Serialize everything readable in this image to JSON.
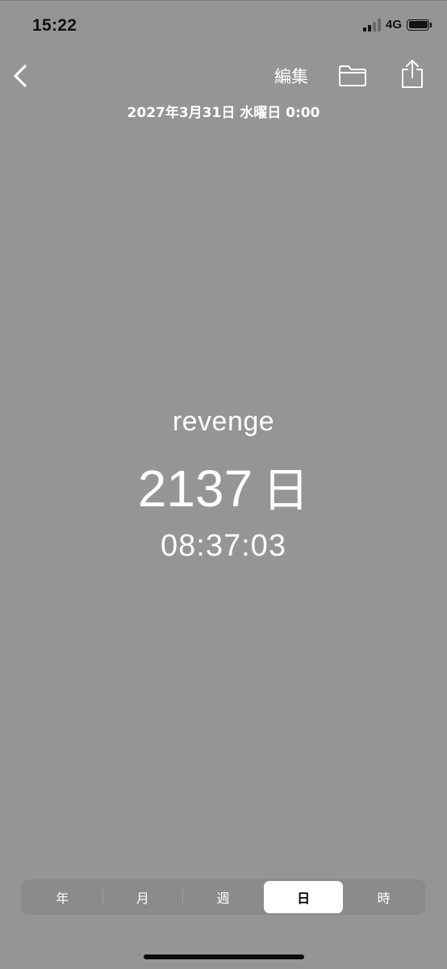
{
  "status_bar": {
    "time": "15:22",
    "network": "4G"
  },
  "nav": {
    "back_icon": "chevron-left-icon",
    "edit_label": "編集",
    "folder_icon": "folder-icon",
    "share_icon": "share-icon"
  },
  "header": {
    "date": "2027年3月31日 水曜日 0:00"
  },
  "countdown": {
    "event_name": "revenge",
    "value": "2137",
    "unit": "日",
    "time": "08:37:03"
  },
  "segments": {
    "items": [
      "年",
      "月",
      "週",
      "日",
      "時"
    ],
    "selected": "日"
  },
  "colors": {
    "background": "#959595",
    "text": "#ffffff",
    "segment_selected_bg": "#ffffff"
  }
}
